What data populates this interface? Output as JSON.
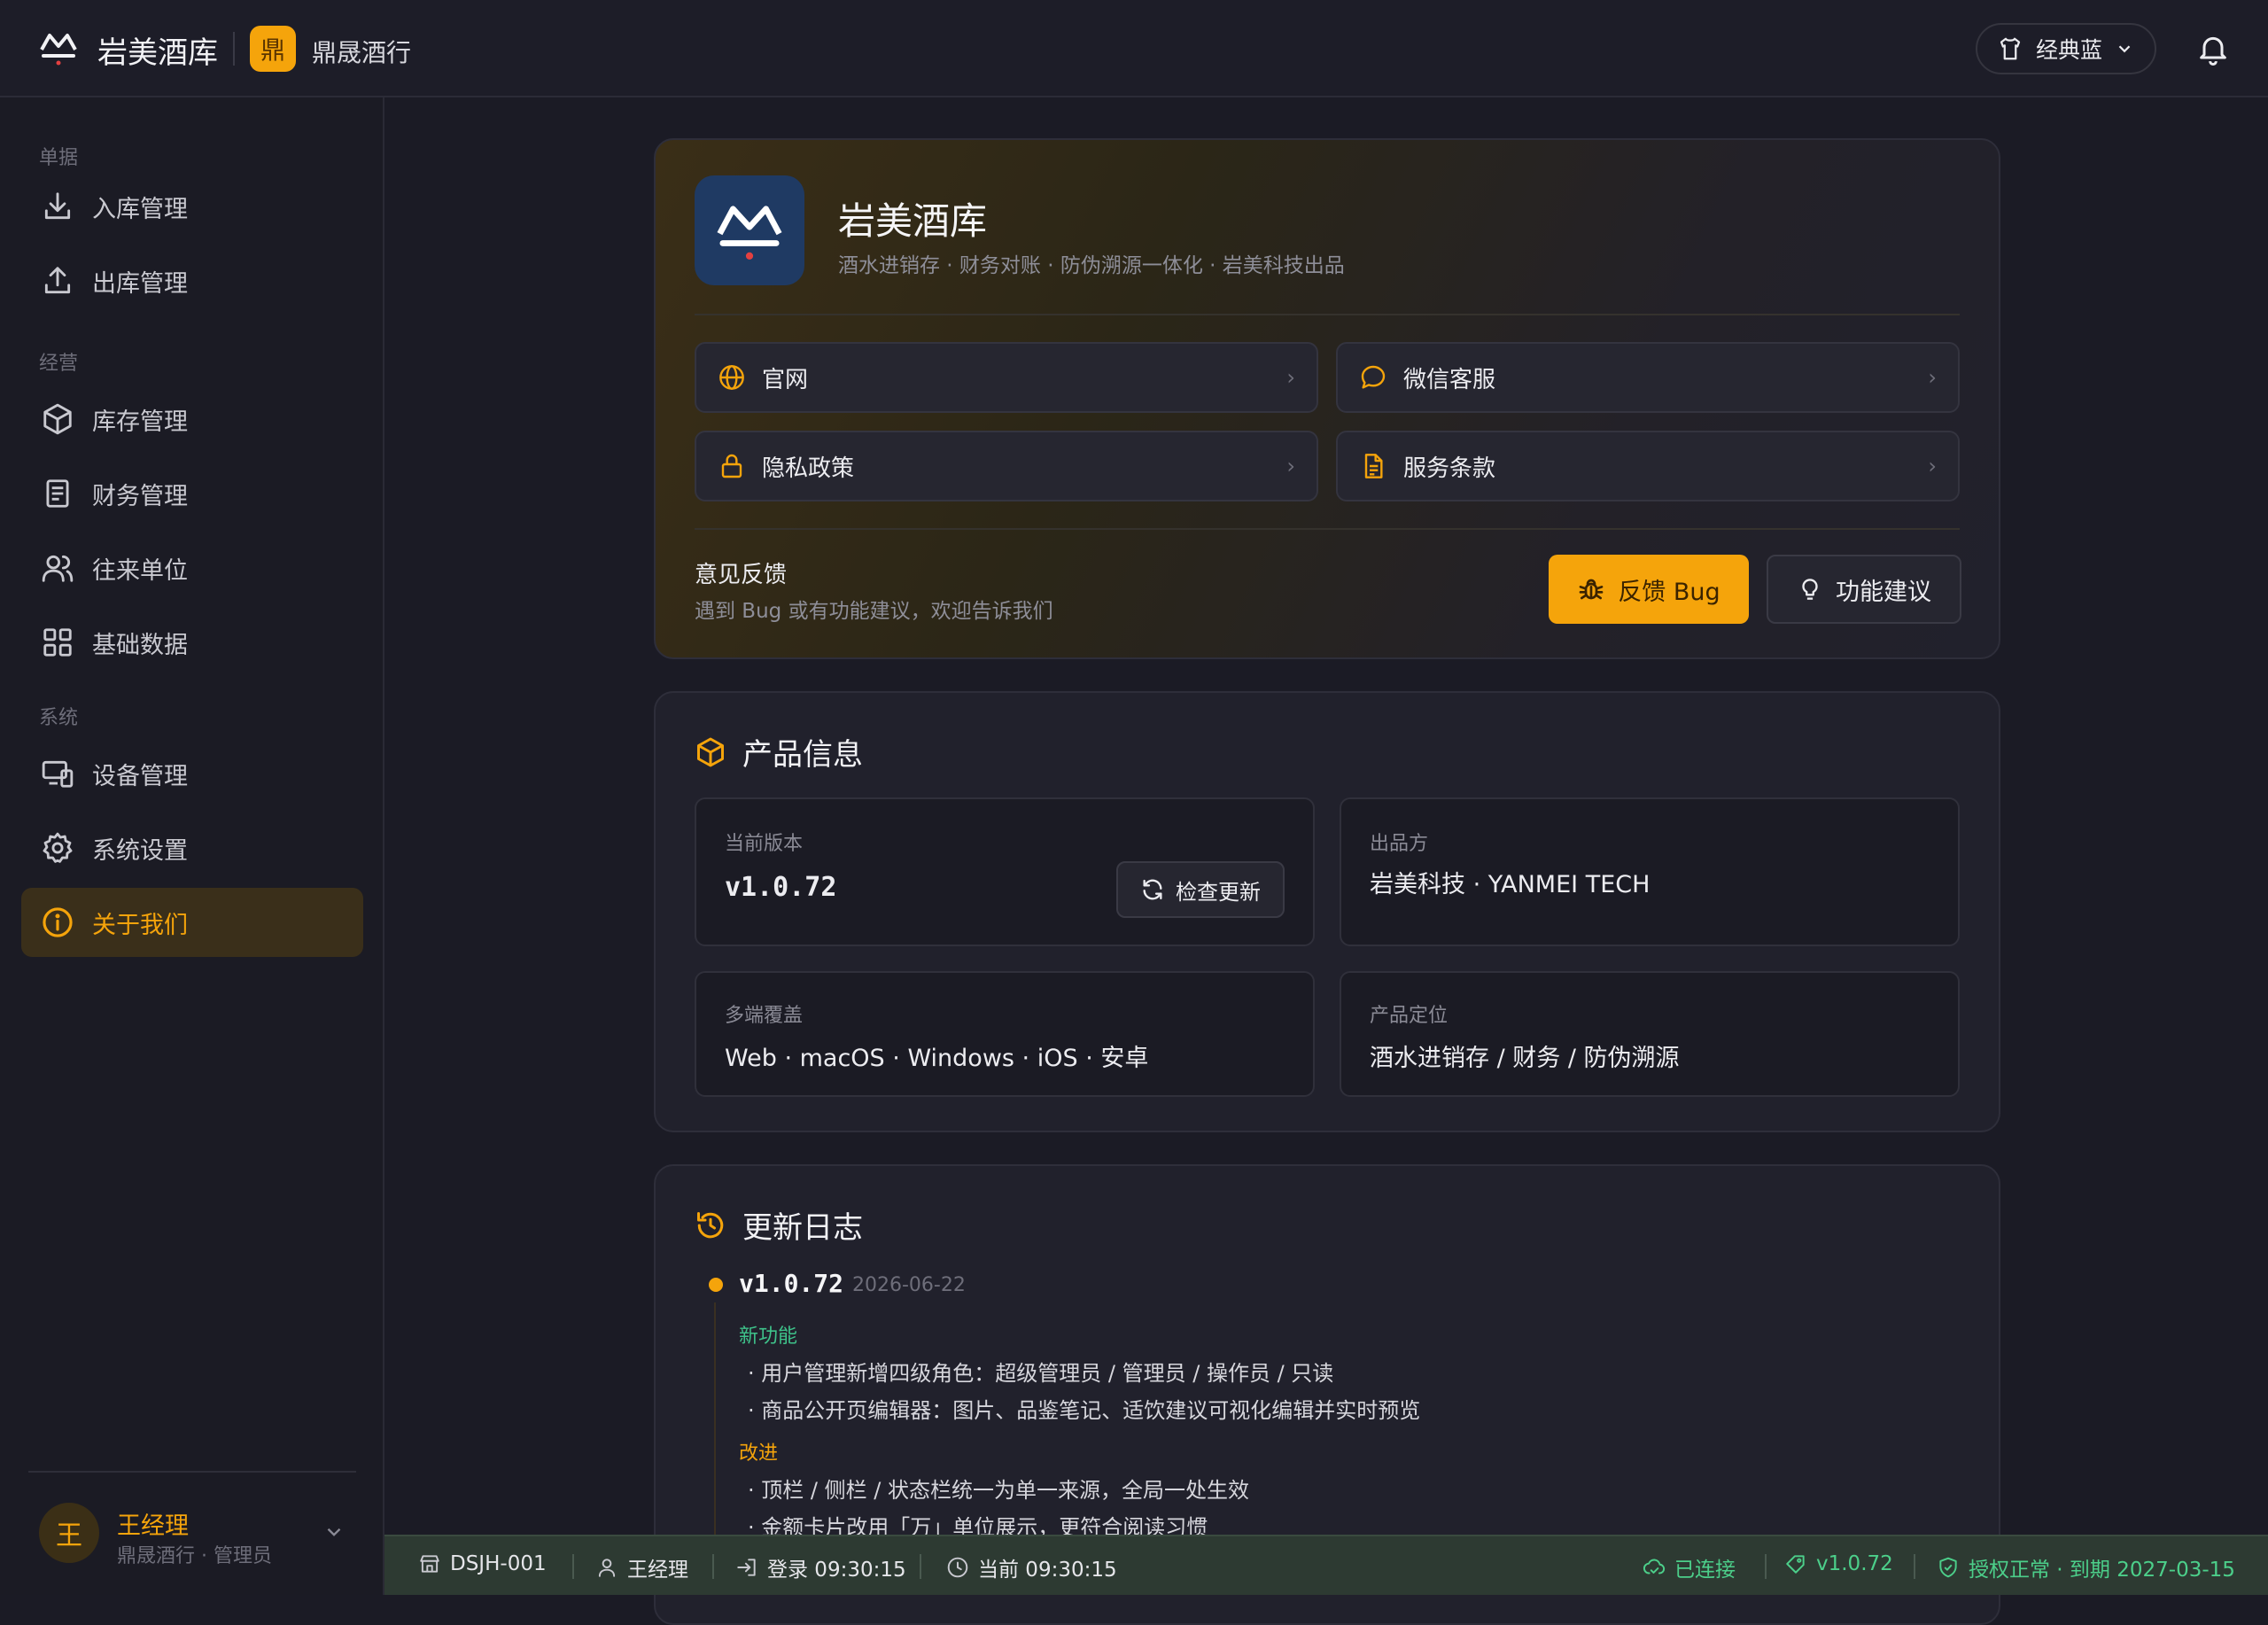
{
  "topbar": {
    "app_title": "岩美酒库",
    "store_badge": "鼎",
    "store_name": "鼎晟酒行",
    "theme_label": "经典蓝"
  },
  "sidebar": {
    "sections": {
      "docs": "单据",
      "ops": "经营",
      "system": "系统"
    },
    "items": [
      {
        "label": "入库管理",
        "icon": "inbound-icon"
      },
      {
        "label": "出库管理",
        "icon": "outbound-icon"
      },
      {
        "label": "库存管理",
        "icon": "box-icon"
      },
      {
        "label": "财务管理",
        "icon": "receipt-icon"
      },
      {
        "label": "往来单位",
        "icon": "users-icon"
      },
      {
        "label": "基础数据",
        "icon": "grid-icon"
      },
      {
        "label": "设备管理",
        "icon": "devices-icon"
      },
      {
        "label": "系统设置",
        "icon": "gear-icon"
      },
      {
        "label": "关于我们",
        "icon": "info-icon",
        "active": true
      }
    ],
    "user": {
      "avatar": "王",
      "name": "王经理",
      "role": "鼎晟酒行 · 管理员"
    }
  },
  "about": {
    "title": "岩美酒库",
    "subtitle": "酒水进销存 · 财务对账 · 防伪溯源一体化 · 岩美科技出品",
    "links": {
      "website": "官网",
      "wechat": "微信客服",
      "privacy": "隐私政策",
      "terms": "服务条款"
    },
    "feedback": {
      "title": "意见反馈",
      "subtitle": "遇到 Bug 或有功能建议，欢迎告诉我们",
      "bug_button": "反馈 Bug",
      "suggest_button": "功能建议"
    }
  },
  "product": {
    "heading": "产品信息",
    "version_label": "当前版本",
    "version": "v1.0.72",
    "check_update": "检查更新",
    "vendor_label": "出品方",
    "vendor": "岩美科技 · YANMEI TECH",
    "platforms_label": "多端覆盖",
    "platforms": "Web · macOS · Windows · iOS · 安卓",
    "positioning_label": "产品定位",
    "positioning": "酒水进销存 / 财务 / 防伪溯源"
  },
  "changelog": {
    "heading": "更新日志",
    "version": "v1.0.72",
    "date": "2026-06-22",
    "new_tag": "新功能",
    "new_items": [
      "· 用户管理新增四级角色：超级管理员 / 管理员 / 操作员 / 只读",
      "· 商品公开页编辑器：图片、品鉴笔记、适饮建议可视化编辑并实时预览"
    ],
    "improve_tag": "改进",
    "improve_items": [
      "· 顶栏 / 侧栏 / 状态栏统一为单一来源，全局一处生效",
      "· 金额卡片改用「万」单位展示，更符合阅读习惯"
    ]
  },
  "statusbar": {
    "device": "DSJH-001",
    "user": "王经理",
    "login": "登录 09:30:15",
    "now": "当前 09:30:15",
    "connection": "已连接",
    "version": "v1.0.72",
    "license": "授权正常 · 到期 2027-03-15"
  },
  "colors": {
    "accent": "#f5a40b",
    "status_ok": "#4ccf8a",
    "new_tag": "#3ec28a"
  }
}
